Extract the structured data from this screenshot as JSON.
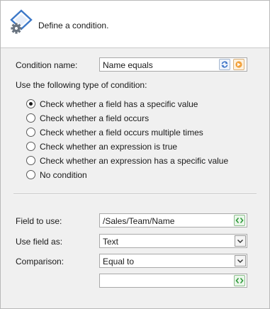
{
  "header": {
    "title": "Define a condition."
  },
  "condition_name": {
    "label": "Condition name:",
    "value": "Name equals"
  },
  "type_section": {
    "label": "Use the following type of condition:",
    "options": [
      {
        "label": "Check whether a field has a specific value",
        "selected": true
      },
      {
        "label": "Check whether a field occurs",
        "selected": false
      },
      {
        "label": "Check whether a field occurs multiple times",
        "selected": false
      },
      {
        "label": "Check whether an expression is true",
        "selected": false
      },
      {
        "label": "Check whether an expression has a specific value",
        "selected": false
      },
      {
        "label": "No condition",
        "selected": false
      }
    ]
  },
  "field_to_use": {
    "label": "Field to use:",
    "value": "/Sales/Team/Name"
  },
  "use_field_as": {
    "label": "Use field as:",
    "value": "Text"
  },
  "comparison": {
    "label": "Comparison:",
    "value": "Equal to"
  },
  "comparison_value": {
    "value": ""
  }
}
